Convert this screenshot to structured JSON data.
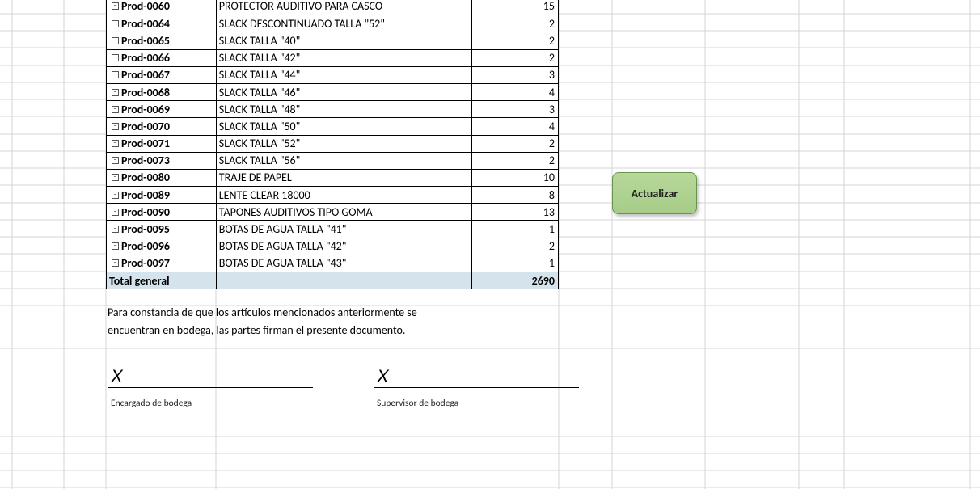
{
  "rows": [
    {
      "code": "Prod-0060",
      "desc": "PROTECTOR AUDITIVO PARA CASCO",
      "qty": 15
    },
    {
      "code": "Prod-0064",
      "desc": "SLACK DESCONTINUADO TALLA \"52\"",
      "qty": 2
    },
    {
      "code": "Prod-0065",
      "desc": "SLACK TALLA \"40\"",
      "qty": 2
    },
    {
      "code": "Prod-0066",
      "desc": "SLACK TALLA \"42\"",
      "qty": 2
    },
    {
      "code": "Prod-0067",
      "desc": "SLACK TALLA \"44\"",
      "qty": 3
    },
    {
      "code": "Prod-0068",
      "desc": "SLACK TALLA \"46\"",
      "qty": 4
    },
    {
      "code": "Prod-0069",
      "desc": "SLACK TALLA \"48\"",
      "qty": 3
    },
    {
      "code": "Prod-0070",
      "desc": "SLACK TALLA \"50\"",
      "qty": 4
    },
    {
      "code": "Prod-0071",
      "desc": "SLACK TALLA \"52\"",
      "qty": 2
    },
    {
      "code": "Prod-0073",
      "desc": "SLACK TALLA \"56\"",
      "qty": 2
    },
    {
      "code": "Prod-0080",
      "desc": "TRAJE DE PAPEL",
      "qty": 10
    },
    {
      "code": "Prod-0089",
      "desc": "LENTE CLEAR 18000",
      "qty": 8
    },
    {
      "code": "Prod-0090",
      "desc": "TAPONES AUDITIVOS TIPO GOMA",
      "qty": 13
    },
    {
      "code": "Prod-0095",
      "desc": "BOTAS DE AGUA TALLA \"41\"",
      "qty": 1
    },
    {
      "code": "Prod-0096",
      "desc": "BOTAS DE AGUA TALLA \"42\"",
      "qty": 2
    },
    {
      "code": "Prod-0097",
      "desc": "BOTAS DE AGUA TALLA \"43\"",
      "qty": 1
    }
  ],
  "total_label": "Total general",
  "total_value": 2690,
  "note_line1": "Para constancia de que los artículos mencionados anteriormente se",
  "note_line2": "encuentran en bodega, las partes firman el presente documento.",
  "sig1_label": "Encargado de bodega",
  "sig2_label": "Supervisor de bodega",
  "x_mark": "X",
  "button_label": "Actualizar"
}
